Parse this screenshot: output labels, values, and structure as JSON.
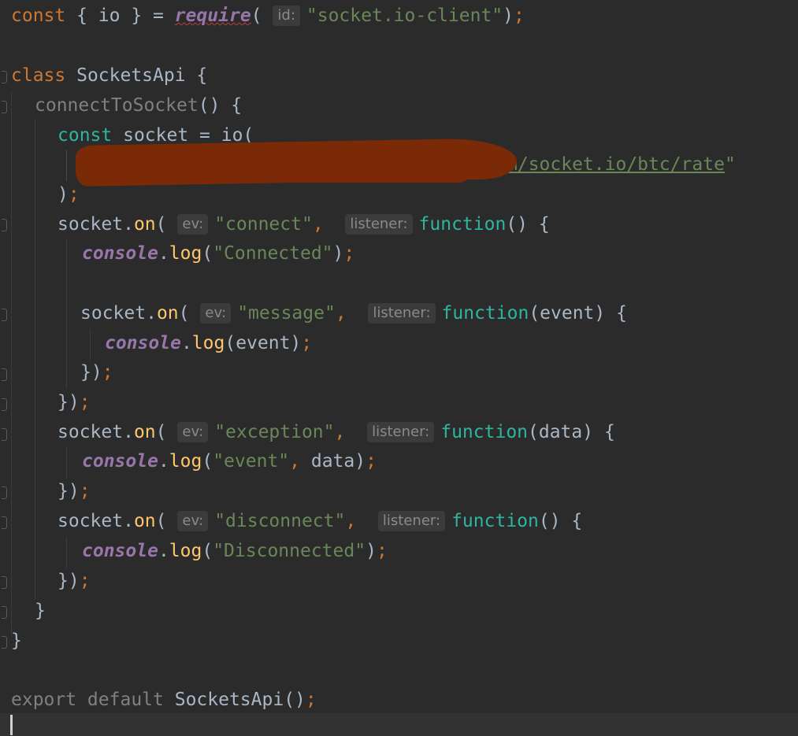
{
  "editor": {
    "lines": {
      "l1": {
        "kw_const": "const",
        "destructure": " { io } = ",
        "require": "require",
        "open": "(",
        "hint_id": "id:",
        "str": "\"socket.io-client\"",
        "close": ")",
        "semi": ";"
      },
      "l3": {
        "kw": "class",
        "name": " SocketsApi {"
      },
      "l4": {
        "method": "connectToSocket",
        "rest": "() {"
      },
      "l5": {
        "kw": "const",
        "rest": " socket = io("
      },
      "l6": {
        "url_visible": "m/socket.io/btc/rate",
        "quote": "\""
      },
      "l7": {
        "paren": ")",
        "semi": ";"
      },
      "l8": {
        "obj": "socket",
        "dot": ".",
        "fn": "on",
        "open": "(",
        "hint_ev": "ev:",
        "str": "\"connect\"",
        "comma": ",",
        "hint_listener": "listener:",
        "kw": "function",
        "rest": "() {"
      },
      "l9": {
        "obj": "console",
        "dot": ".",
        "fn": "log",
        "open": "(",
        "str": "\"Connected\"",
        "close": ")",
        "semi": ";"
      },
      "l11": {
        "obj": "socket",
        "dot": ".",
        "fn": "on",
        "open": "(",
        "hint_ev": "ev:",
        "str": "\"message\"",
        "comma": ",",
        "hint_listener": "listener:",
        "kw": "function",
        "rest": "(event) {"
      },
      "l12": {
        "obj": "console",
        "dot": ".",
        "fn": "log",
        "rest": "(event)",
        "semi": ";"
      },
      "l13": {
        "rest": "})",
        "semi": ";"
      },
      "l14": {
        "rest": "})",
        "semi": ";"
      },
      "l15": {
        "obj": "socket",
        "dot": ".",
        "fn": "on",
        "open": "(",
        "hint_ev": "ev:",
        "str": "\"exception\"",
        "comma": ",",
        "hint_listener": "listener:",
        "kw": "function",
        "rest": "(data) {"
      },
      "l16": {
        "obj": "console",
        "dot": ".",
        "fn": "log",
        "open": "(",
        "str": "\"event\"",
        "comma": ",",
        "rest": " data)",
        "semi": ";"
      },
      "l17": {
        "rest": "})",
        "semi": ";"
      },
      "l18": {
        "obj": "socket",
        "dot": ".",
        "fn": "on",
        "open": "(",
        "hint_ev": "ev:",
        "str": "\"disconnect\"",
        "comma": ",",
        "hint_listener": "listener:",
        "kw": "function",
        "rest": "() {"
      },
      "l19": {
        "obj": "console",
        "dot": ".",
        "fn": "log",
        "open": "(",
        "str": "\"Disconnected\"",
        "close": ")",
        "semi": ";"
      },
      "l20": {
        "rest": "})",
        "semi": ";"
      },
      "l21": {
        "rest": "}"
      },
      "l22": {
        "rest": "}"
      },
      "l24": {
        "kw": "export default",
        "name": " SocketsApi()",
        "semi": ";"
      }
    }
  },
  "colors": {
    "background": "#2b2b2b",
    "keyword": "#cc7832",
    "string": "#6a8759",
    "function": "#ffc66d",
    "object": "#9876aa",
    "redaction": "#7a2a06"
  }
}
